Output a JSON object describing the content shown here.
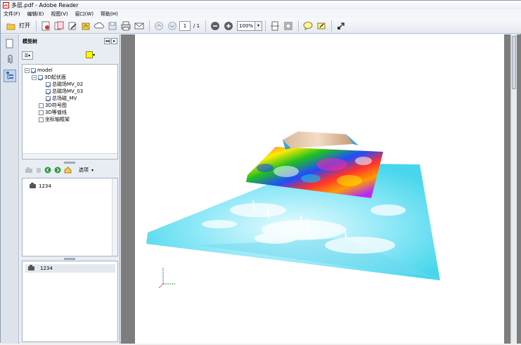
{
  "window": {
    "title": "多层.pdf - Adobe Reader"
  },
  "menu": {
    "items": [
      "文件(F)",
      "编辑(E)",
      "视图(V)",
      "窗口(W)",
      "帮助(H)"
    ]
  },
  "toolbar": {
    "open_label": "打开",
    "page_current": "1",
    "page_total": "/ 1",
    "zoom": "100%"
  },
  "panel": {
    "title": "模型树",
    "options_label": "选项"
  },
  "tree": {
    "items": [
      {
        "label": "model",
        "checked": true
      },
      {
        "label": "3D起伏面",
        "checked": true
      },
      {
        "label": "总磁场MV_02",
        "checked": true
      },
      {
        "label": "总磁场MV_03",
        "checked": true
      },
      {
        "label": "总场磁_MV",
        "checked": true
      },
      {
        "label": "3D符号图",
        "checked": false
      },
      {
        "label": "3D等值线",
        "checked": false
      },
      {
        "label": "坐标轴框架",
        "checked": false
      }
    ]
  },
  "views": {
    "items": [
      "1234"
    ]
  },
  "details": {
    "label": "1234"
  }
}
